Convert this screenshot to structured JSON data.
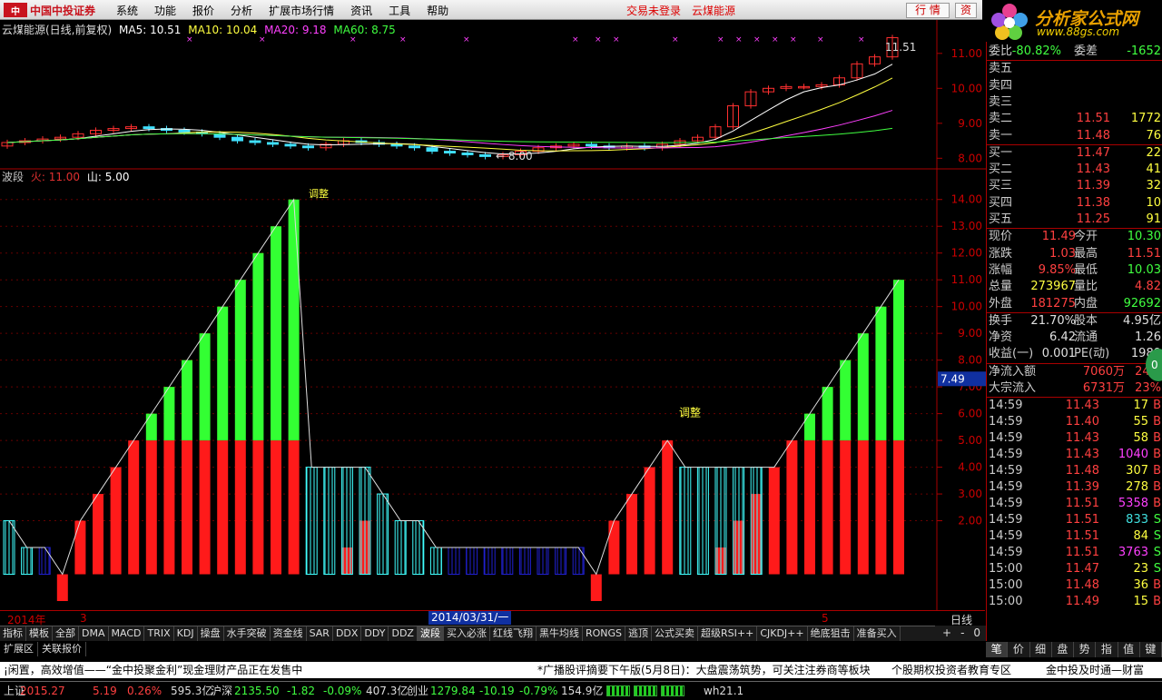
{
  "topbar": {
    "logo_mark": "中",
    "logo_text": "中国中投证券",
    "menus": [
      "系统",
      "功能",
      "报价",
      "分析",
      "扩展市场行情",
      "资讯",
      "工具",
      "帮助"
    ],
    "right_links": [
      "交易未登录",
      "云煤能源"
    ],
    "btn_hq": "行 情",
    "btn_zi": "资"
  },
  "brand": {
    "title": "分析家公式网",
    "url": "www.88gs.com"
  },
  "main_chart": {
    "title": "云煤能源(日线,前复权)",
    "ma5": "MA5: 10.51",
    "ma10": "MA10: 10.04",
    "ma20": "MA20: 9.18",
    "ma60": "MA60: 8.75",
    "high_label": "11.51",
    "low_label": "8.00",
    "yticks": [
      "11.00",
      "10.00",
      "9.00",
      "8.00"
    ],
    "colors": {
      "up": "#ff3030",
      "down": "#40e0ff",
      "ma5": "#ffffff",
      "ma10": "#ffff40",
      "ma20": "#ff40ff",
      "ma60": "#40ff40"
    }
  },
  "indicator": {
    "name": "波段",
    "fire_label": "火: 11.00",
    "mountain_label": "山: 5.00",
    "annotation_top": "调整",
    "annotation_mid": "调整",
    "cursor_value": "7.49",
    "yticks": [
      "14.00",
      "13.00",
      "12.00",
      "11.00",
      "10.00",
      "9.00",
      "8.00",
      "7.00",
      "6.00",
      "5.00",
      "4.00",
      "3.00",
      "2.00"
    ]
  },
  "datebar": {
    "year": "2014年",
    "m3": "3",
    "cursor_date": "2014/03/31/一",
    "m5": "5",
    "period": "日线"
  },
  "tabs": [
    "指标",
    "模板",
    "全部",
    "DMA",
    "MACD",
    "TRIX",
    "KDJ",
    "操盘",
    "水手突破",
    "资金线",
    "SAR",
    "DDX",
    "DDY",
    "DDZ",
    "波段",
    "买入必涨",
    "红线飞翔",
    "黑牛均线",
    "RONGS",
    "逃顶",
    "公式买卖",
    "超级RSI++",
    "CJKDJ++",
    "绝底狙击",
    "准备买入"
  ],
  "tab_active": "波段",
  "tab_controls": [
    "+",
    "-",
    "0"
  ],
  "tabs2": [
    "扩展区",
    "关联报价"
  ],
  "right": {
    "weibi": {
      "label": "委比",
      "value": "-80.82%",
      "label2": "委差",
      "value2": "-1652"
    },
    "sell": [
      {
        "label": "卖五",
        "price": "",
        "vol": ""
      },
      {
        "label": "卖四",
        "price": "",
        "vol": ""
      },
      {
        "label": "卖三",
        "price": "",
        "vol": ""
      },
      {
        "label": "卖二",
        "price": "11.51",
        "vol": "1772"
      },
      {
        "label": "卖一",
        "price": "11.48",
        "vol": "76"
      }
    ],
    "buy": [
      {
        "label": "买一",
        "price": "11.47",
        "vol": "22"
      },
      {
        "label": "买二",
        "price": "11.43",
        "vol": "41"
      },
      {
        "label": "买三",
        "price": "11.39",
        "vol": "32"
      },
      {
        "label": "买四",
        "price": "11.38",
        "vol": "10"
      },
      {
        "label": "买五",
        "price": "11.25",
        "vol": "91"
      }
    ],
    "quote": [
      {
        "l1": "现价",
        "v1": "11.49",
        "c1": "red",
        "l2": "今开",
        "v2": "10.30",
        "c2": "grn"
      },
      {
        "l1": "涨跌",
        "v1": "1.03",
        "c1": "red",
        "l2": "最高",
        "v2": "11.51",
        "c2": "red"
      },
      {
        "l1": "涨幅",
        "v1": "9.85%",
        "c1": "red",
        "l2": "最低",
        "v2": "10.03",
        "c2": "grn"
      },
      {
        "l1": "总量",
        "v1": "273967",
        "c1": "yel",
        "l2": "量比",
        "v2": "4.82",
        "c2": "red"
      },
      {
        "l1": "外盘",
        "v1": "181275",
        "c1": "red",
        "l2": "内盘",
        "v2": "92692",
        "c2": "grn"
      }
    ],
    "quote2": [
      {
        "l1": "换手",
        "v1": "21.70%",
        "l2": "股本",
        "v2": "4.95亿"
      },
      {
        "l1": "净资",
        "v1": "6.42",
        "l2": "流通",
        "v2": "1.26"
      },
      {
        "l1": "收益(一)",
        "v1": "0.001",
        "l2": "PE(动)",
        "v2": "1989"
      }
    ],
    "flow": [
      {
        "label": "净流入额",
        "v1": "7060万",
        "v2": "24%"
      },
      {
        "label": "大宗流入",
        "v1": "6731万",
        "v2": "23%"
      }
    ],
    "ticks": [
      {
        "t": "14:59",
        "p": "11.43",
        "pc": "red",
        "v": "17",
        "vc": "yel",
        "s": "B",
        "sc": "red"
      },
      {
        "t": "14:59",
        "p": "11.40",
        "pc": "red",
        "v": "55",
        "vc": "yel",
        "s": "B",
        "sc": "red"
      },
      {
        "t": "14:59",
        "p": "11.43",
        "pc": "red",
        "v": "58",
        "vc": "yel",
        "s": "B",
        "sc": "red"
      },
      {
        "t": "14:59",
        "p": "11.43",
        "pc": "red",
        "v": "1040",
        "vc": "mag",
        "s": "B",
        "sc": "red"
      },
      {
        "t": "14:59",
        "p": "11.48",
        "pc": "red",
        "v": "307",
        "vc": "yel",
        "s": "B",
        "sc": "red"
      },
      {
        "t": "14:59",
        "p": "11.39",
        "pc": "red",
        "v": "278",
        "vc": "yel",
        "s": "B",
        "sc": "red"
      },
      {
        "t": "14:59",
        "p": "11.51",
        "pc": "red",
        "v": "5358",
        "vc": "mag",
        "s": "B",
        "sc": "red"
      },
      {
        "t": "14:59",
        "p": "11.51",
        "pc": "red",
        "v": "833",
        "vc": "cyn",
        "s": "S",
        "sc": "grn"
      },
      {
        "t": "14:59",
        "p": "11.51",
        "pc": "red",
        "v": "84",
        "vc": "yel",
        "s": "S",
        "sc": "grn"
      },
      {
        "t": "14:59",
        "p": "11.51",
        "pc": "red",
        "v": "3763",
        "vc": "mag",
        "s": "S",
        "sc": "grn"
      },
      {
        "t": "15:00",
        "p": "11.47",
        "pc": "red",
        "v": "23",
        "vc": "yel",
        "s": "S",
        "sc": "grn"
      },
      {
        "t": "15:00",
        "p": "11.48",
        "pc": "red",
        "v": "36",
        "vc": "yel",
        "s": "B",
        "sc": "red"
      },
      {
        "t": "15:00",
        "p": "11.49",
        "pc": "red",
        "v": "15",
        "vc": "yel",
        "s": "B",
        "sc": "red"
      }
    ],
    "tabs": [
      "笔",
      "价",
      "细",
      "盘",
      "势",
      "指",
      "值",
      "键"
    ],
    "badge": "0"
  },
  "ticker": [
    "¡闲置，高效增值——“金中投聚金利”现金理财产品正在发售中",
    "*广播股评摘要下午版(5月8日)：大盘震荡筑势，可关注注券商等板块",
    "个股期权投资者教育专区",
    "金中投及时通—财富"
  ],
  "status": {
    "sh_label": "上证",
    "sh_val": "2015.27",
    "sh_chg": "5.19",
    "sh_pct": "0.26%",
    "sh_amt": "595.3亿",
    "hs_label": "沪深",
    "hs_val": "2135.50",
    "hs_chg": "-1.82",
    "hs_pct": "-0.09%",
    "hs_amt": "407.3亿",
    "cy_label": "创业",
    "cy_val": "1279.84",
    "cy_chg": "-10.19",
    "cy_pct": "-0.79%",
    "cy_amt": "154.9亿",
    "host": "wh21.1"
  },
  "chart_data": {
    "type": "bar",
    "title": "波段",
    "series": [
      {
        "name": "红",
        "color": "#ff1a1a",
        "values": [
          0,
          0,
          0,
          -1,
          2,
          3,
          4,
          5,
          5,
          5,
          5,
          5,
          5,
          5,
          5,
          5,
          5,
          0,
          0,
          1,
          2,
          0,
          0,
          0,
          0,
          0,
          0,
          0,
          0,
          0,
          0,
          0,
          0,
          -1,
          2,
          3,
          4,
          5,
          0,
          0,
          1,
          2,
          3,
          4,
          5,
          5,
          5,
          5,
          5,
          5,
          5
        ]
      },
      {
        "name": "绿",
        "color": "#33ff33",
        "values": [
          0,
          0,
          0,
          0,
          0,
          0,
          0,
          0,
          6,
          7,
          8,
          9,
          10,
          11,
          12,
          13,
          14,
          0,
          0,
          0,
          0,
          0,
          0,
          0,
          0,
          0,
          0,
          0,
          0,
          0,
          0,
          0,
          0,
          0,
          0,
          0,
          0,
          0,
          0,
          0,
          0,
          0,
          0,
          0,
          0,
          6,
          7,
          8,
          9,
          10,
          11
        ]
      },
      {
        "name": "青",
        "color": "#40ffff",
        "values": [
          2,
          1,
          0,
          0,
          0,
          0,
          0,
          0,
          0,
          0,
          0,
          0,
          0,
          0,
          0,
          0,
          0,
          4,
          4,
          4,
          4,
          3,
          2,
          2,
          1,
          0,
          0,
          0,
          0,
          0,
          0,
          0,
          0,
          0,
          0,
          0,
          0,
          0,
          4,
          4,
          4,
          4,
          4,
          0,
          0,
          0,
          0,
          0,
          0,
          0,
          0
        ]
      },
      {
        "name": "蓝",
        "color": "#2020d0",
        "values": [
          0,
          0,
          1,
          0,
          0,
          0,
          0,
          0,
          0,
          0,
          0,
          0,
          0,
          0,
          0,
          0,
          0,
          0,
          0,
          0,
          0,
          0,
          0,
          0,
          0,
          1,
          1,
          1,
          1,
          1,
          1,
          1,
          1,
          0,
          0,
          0,
          0,
          0,
          0,
          0,
          0,
          0,
          0,
          0,
          0,
          0,
          0,
          0,
          0,
          0,
          0
        ]
      }
    ],
    "ylim": [
      -1,
      14.5
    ]
  }
}
